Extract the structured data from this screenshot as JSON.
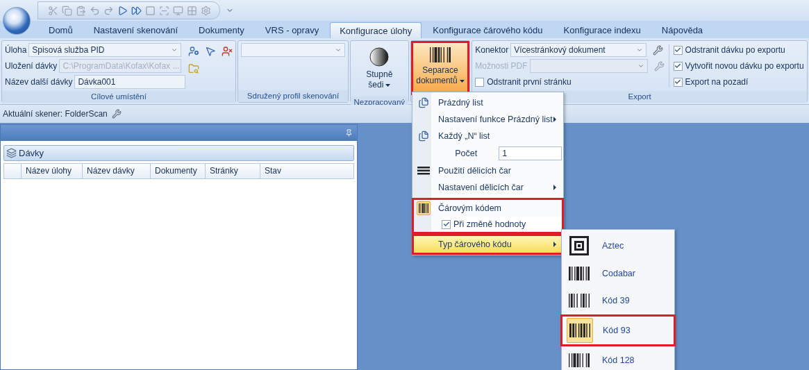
{
  "tabs": [
    {
      "label": "Domů",
      "selected": false
    },
    {
      "label": "Nastavení skenování",
      "selected": false
    },
    {
      "label": "Dokumenty",
      "selected": false
    },
    {
      "label": "VRS - opravy",
      "selected": false
    },
    {
      "label": "Konfigurace úlohy",
      "selected": true
    },
    {
      "label": "Konfigurace čárového kódu",
      "selected": false
    },
    {
      "label": "Konfigurace indexu",
      "selected": false
    },
    {
      "label": "Nápověda",
      "selected": false
    }
  ],
  "target_group": {
    "label": "Cílové umístění",
    "fields": [
      {
        "label": "Úloha",
        "value": "Spisová služba PID",
        "kind": "dropdown",
        "disabled": false
      },
      {
        "label": "Uložení dávky",
        "value": "C:\\ProgramData\\Kofax\\Kofax ...",
        "kind": "text",
        "disabled": true
      },
      {
        "label": "Název další dávky",
        "value": "Dávka001",
        "kind": "text",
        "disabled": false
      }
    ]
  },
  "profile_group": {
    "label": "Sdružený profil skenování"
  },
  "raw_group": {
    "label": "Nezpracovaný",
    "button": "Stupně šedi"
  },
  "separation": {
    "button": "Separace dokumentů",
    "selected": true,
    "highlighted": true
  },
  "export_group": {
    "label": "Export",
    "connector": {
      "label": "Konektor",
      "value": "Vícestránkový dokument",
      "disabled": false
    },
    "pdf": {
      "label": "Možnosti PDF",
      "disabled": true
    },
    "remove_first": {
      "label": "Odstranit první stránku",
      "checked": false
    },
    "checkboxes": [
      {
        "label": "Odstranit dávku po exportu",
        "checked": true
      },
      {
        "label": "Vytvořit novou dávku po exportu",
        "checked": true
      },
      {
        "label": "Export na pozadí",
        "checked": true
      }
    ]
  },
  "status": "Aktuální skener: FolderScan",
  "panel": {
    "title": "Dávky",
    "columns": [
      "Název úlohy",
      "Název dávky",
      "Dokumenty",
      "Stránky",
      "Stav"
    ]
  },
  "menu": {
    "sections": [
      {
        "highlighted": false,
        "items": [
          {
            "kind": "pages",
            "label": "Prázdný list",
            "submenu": false,
            "checked": false,
            "selected": false
          },
          {
            "kind": "plain",
            "label": "Nastavení funkce Prázdný list",
            "submenu": true,
            "selected": false
          },
          {
            "kind": "pages",
            "label": "Každý „N“ list",
            "submenu": false,
            "checked": false,
            "selected": false
          },
          {
            "kind": "field",
            "label": "Počet",
            "value": "1"
          },
          {
            "kind": "lines",
            "label": "Použití dělicích čar",
            "submenu": false,
            "checked": false,
            "selected": false
          },
          {
            "kind": "plain",
            "label": "Nastavení dělicích čar",
            "submenu": true,
            "selected": false
          }
        ]
      },
      {
        "highlighted": true,
        "items": [
          {
            "kind": "barcode",
            "label": "Čárovým kódem",
            "submenu": false,
            "checked": true,
            "selected": false
          },
          {
            "kind": "check",
            "label": "Při změně hodnoty",
            "checked": true
          }
        ]
      },
      {
        "highlighted": true,
        "items": [
          {
            "kind": "plain",
            "label": "Typ čárového kódu",
            "submenu": true,
            "selected": true
          }
        ]
      }
    ]
  },
  "submenu": [
    {
      "kind": "matrix",
      "label": "Aztec",
      "selected": false,
      "highlighted": false
    },
    {
      "kind": "linear",
      "label": "Codabar",
      "selected": false,
      "highlighted": false
    },
    {
      "kind": "linear",
      "label": "Kód 39",
      "selected": false,
      "highlighted": false
    },
    {
      "kind": "linear",
      "label": "Kód 93",
      "selected": true,
      "highlighted": true
    },
    {
      "kind": "linear",
      "label": "Kód 128",
      "selected": false,
      "highlighted": false
    }
  ]
}
